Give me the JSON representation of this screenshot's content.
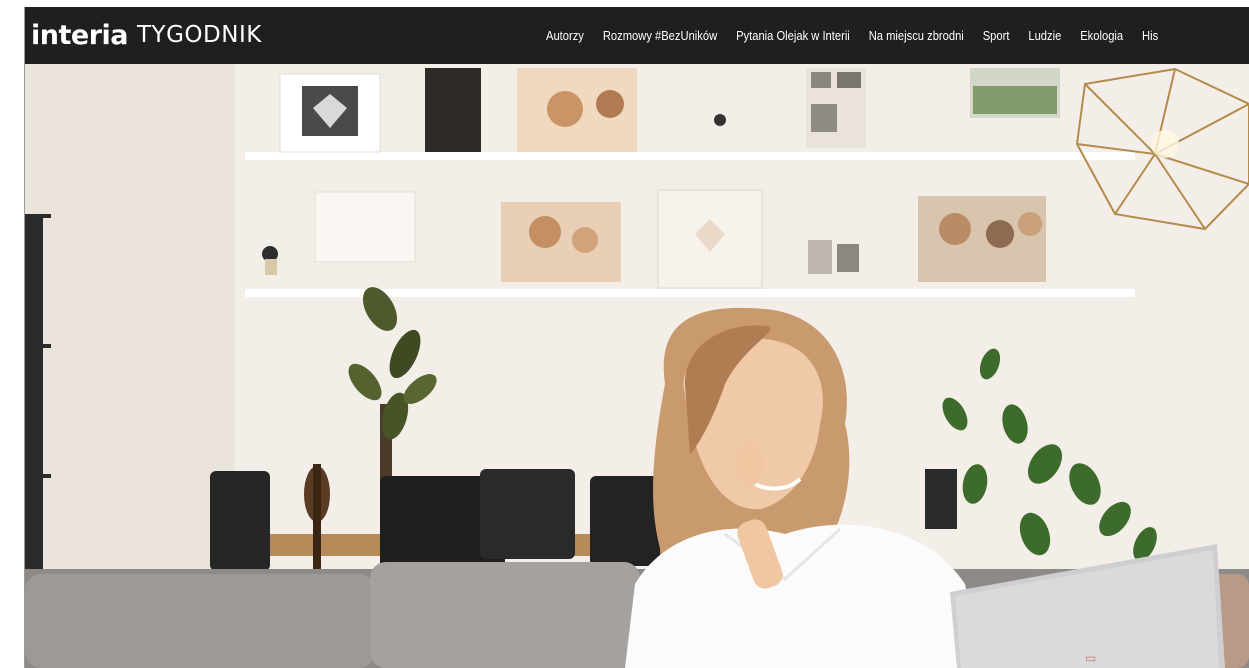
{
  "brand": {
    "logo": "interia",
    "section": "TYGODNIK"
  },
  "nav": {
    "items": [
      "Autorzy",
      "Rozmowy #BezUników",
      "Pytania Olejak w Interii",
      "Na miejscu zbrodni",
      "Sport",
      "Ludzie",
      "Ekologia",
      "His"
    ]
  },
  "colors": {
    "topbar": "#1f1f21",
    "nav_text": "#ffffff"
  }
}
